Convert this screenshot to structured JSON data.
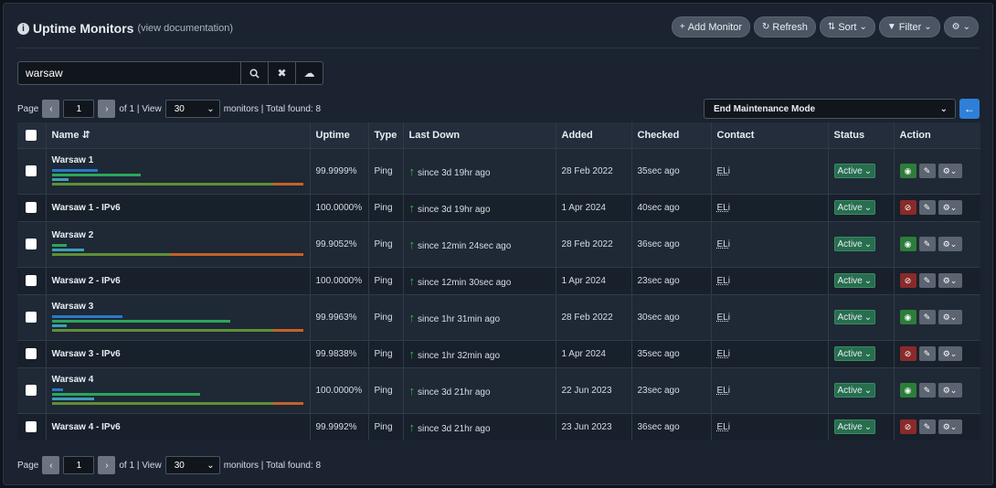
{
  "header": {
    "title": "Uptime Monitors",
    "doc_link": "(view documentation)",
    "buttons": {
      "add": "Add Monitor",
      "refresh": "Refresh",
      "sort": "Sort",
      "filter": "Filter"
    }
  },
  "search": {
    "value": "warsaw"
  },
  "pager_top": {
    "label_page": "Page",
    "page": "1",
    "of": "of 1 | View",
    "per_page": "30",
    "summary": "monitors | Total found: 8"
  },
  "pager_bottom": {
    "label_page": "Page",
    "page": "1",
    "of": "of 1 | View",
    "per_page": "30",
    "summary": "monitors | Total found: 8"
  },
  "maintenance": {
    "selected": "End Maintenance Mode"
  },
  "table": {
    "columns": [
      "Name",
      "Uptime",
      "Type",
      "Last Down",
      "Added",
      "Checked",
      "Contact",
      "Status",
      "Action"
    ],
    "rows": [
      {
        "name": "Warsaw 1",
        "uptime": "99.9999%",
        "type": "Ping",
        "last_down": "since 3d 19hr ago",
        "added": "28 Feb 2022",
        "checked": "35sec ago",
        "contact": "ELi",
        "status": "Active"
      },
      {
        "name": "Warsaw 1 - IPv6",
        "uptime": "100.0000%",
        "type": "Ping",
        "last_down": "since 3d 19hr ago",
        "added": "1 Apr 2024",
        "checked": "40sec ago",
        "contact": "ELi",
        "status": "Active"
      },
      {
        "name": "Warsaw 2",
        "uptime": "99.9052%",
        "type": "Ping",
        "last_down": "since 12min 24sec ago",
        "added": "28 Feb 2022",
        "checked": "36sec ago",
        "contact": "ELi",
        "status": "Active"
      },
      {
        "name": "Warsaw 2 - IPv6",
        "uptime": "100.0000%",
        "type": "Ping",
        "last_down": "since 12min 30sec ago",
        "added": "1 Apr 2024",
        "checked": "23sec ago",
        "contact": "ELi",
        "status": "Active"
      },
      {
        "name": "Warsaw 3",
        "uptime": "99.9963%",
        "type": "Ping",
        "last_down": "since 1hr 31min ago",
        "added": "28 Feb 2022",
        "checked": "30sec ago",
        "contact": "ELi",
        "status": "Active"
      },
      {
        "name": "Warsaw 3 - IPv6",
        "uptime": "99.9838%",
        "type": "Ping",
        "last_down": "since 1hr 32min ago",
        "added": "1 Apr 2024",
        "checked": "35sec ago",
        "contact": "ELi",
        "status": "Active"
      },
      {
        "name": "Warsaw 4",
        "uptime": "100.0000%",
        "type": "Ping",
        "last_down": "since 3d 21hr ago",
        "added": "22 Jun 2023",
        "checked": "23sec ago",
        "contact": "ELi",
        "status": "Active"
      },
      {
        "name": "Warsaw 4 - IPv6",
        "uptime": "99.9992%",
        "type": "Ping",
        "last_down": "since 3d 21hr ago",
        "added": "23 Jun 2023",
        "checked": "36sec ago",
        "contact": "ELi",
        "status": "Active"
      }
    ]
  },
  "colors": {
    "panel": "#1b2330",
    "accent_blue": "#2f7fd8",
    "status_green": "#276e4e",
    "up_arrow": "#39b54a"
  }
}
